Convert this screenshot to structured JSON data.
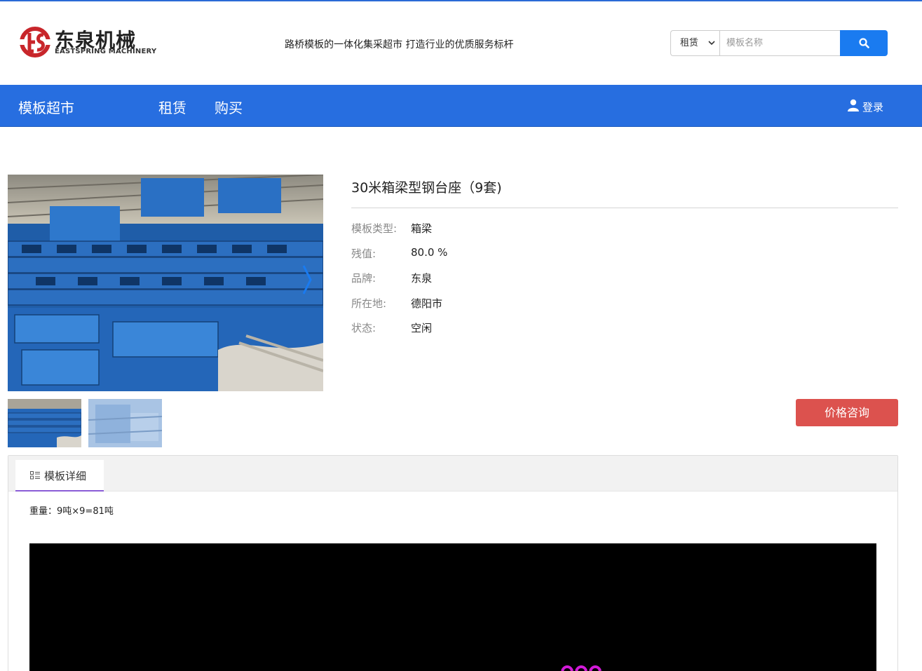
{
  "header": {
    "logo_cn": "东泉机械",
    "logo_en": "EASTSPRING MACHINERY",
    "slogan": "路桥模板的一体化集采超市 打造行业的优质服务标杆",
    "search": {
      "type_selected": "租赁",
      "placeholder": "模板名称",
      "button_icon": "search-icon"
    }
  },
  "nav": {
    "brand": "模板超市",
    "items": [
      {
        "label": "租赁"
      },
      {
        "label": "购买"
      }
    ],
    "login": {
      "label": "登录",
      "icon": "user-icon"
    }
  },
  "product": {
    "title": "30米箱梁型钢台座（9套)",
    "attributes": [
      {
        "label": "模板类型:",
        "value": "箱梁"
      },
      {
        "label": "残值:",
        "value": "80.0 %"
      },
      {
        "label": "品牌:",
        "value": "东泉"
      },
      {
        "label": "所在地:",
        "value": "德阳市"
      },
      {
        "label": "状态:",
        "value": "空闲"
      }
    ],
    "price_button": "价格咨询"
  },
  "details": {
    "tab_label": "模板详细",
    "tab_icon": "list-icon",
    "text": "重量：9吨×9=81吨"
  },
  "colors": {
    "brand_blue": "#276ee0",
    "search_button": "#1a7bf0",
    "price_button": "#dc524e",
    "logo_red": "#c8262b"
  }
}
